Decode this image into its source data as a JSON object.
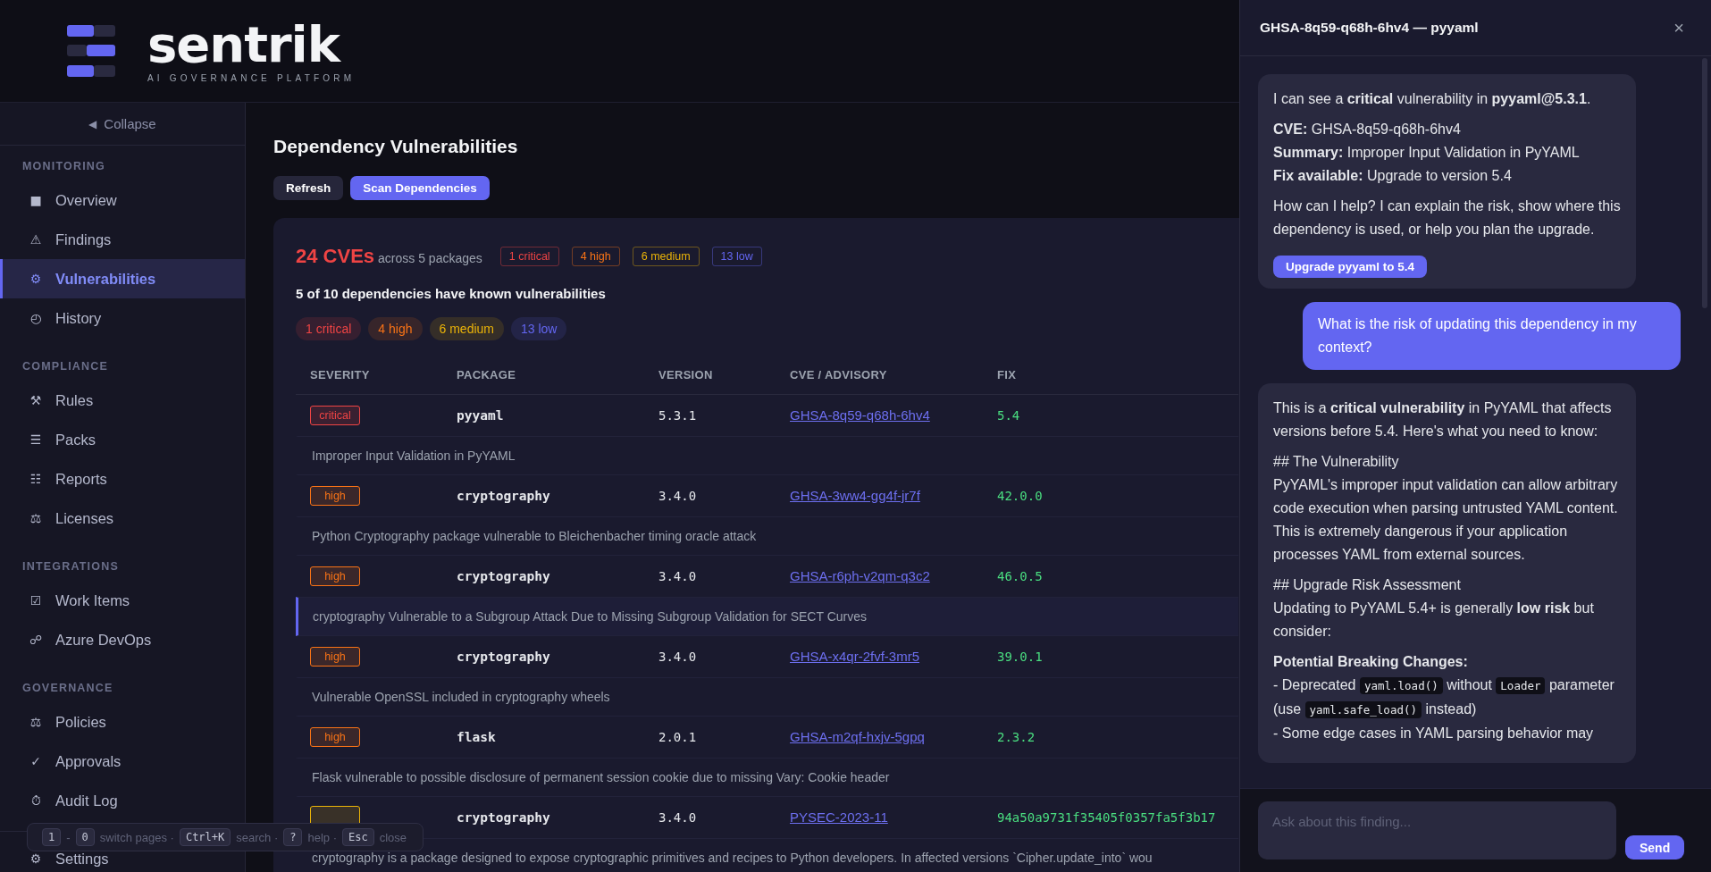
{
  "brand": {
    "name": "sentrik",
    "tagline": "AI GOVERNANCE PLATFORM"
  },
  "sidebar": {
    "collapse": {
      "icon": "◀",
      "label": "Collapse"
    },
    "sections": [
      {
        "label": "MONITORING",
        "items": [
          {
            "icon": "■",
            "label": "Overview",
            "selected": false
          },
          {
            "icon": "⚠",
            "label": "Findings",
            "selected": false
          },
          {
            "icon": "⚙",
            "label": "Vulnerabilities",
            "selected": true
          },
          {
            "icon": "◴",
            "label": "History",
            "selected": false
          }
        ]
      },
      {
        "label": "COMPLIANCE",
        "items": [
          {
            "icon": "⚒",
            "label": "Rules",
            "selected": false
          },
          {
            "icon": "☰",
            "label": "Packs",
            "selected": false
          },
          {
            "icon": "☷",
            "label": "Reports",
            "selected": false
          },
          {
            "icon": "⚖",
            "label": "Licenses",
            "selected": false
          }
        ]
      },
      {
        "label": "INTEGRATIONS",
        "items": [
          {
            "icon": "☑",
            "label": "Work Items",
            "selected": false
          },
          {
            "icon": "☍",
            "label": "Azure DevOps",
            "selected": false
          }
        ]
      },
      {
        "label": "GOVERNANCE",
        "items": [
          {
            "icon": "⚖",
            "label": "Policies",
            "selected": false
          },
          {
            "icon": "✓",
            "label": "Approvals",
            "selected": false
          },
          {
            "icon": "⏱",
            "label": "Audit Log",
            "selected": false
          }
        ]
      }
    ],
    "footer_items": [
      {
        "icon": "⚙",
        "label": "Settings",
        "selected": false
      }
    ]
  },
  "page": {
    "title": "Dependency Vulnerabilities",
    "actions": [
      {
        "label": "Refresh",
        "kind": "secondary"
      },
      {
        "label": "Scan Dependencies",
        "kind": "primary"
      }
    ]
  },
  "summary": {
    "count": "24 CVEs",
    "caption": "across 5 packages",
    "tags": [
      {
        "color": "#ef4444",
        "label": "1 critical"
      },
      {
        "color": "#f97316",
        "label": "4 high"
      },
      {
        "color": "#eab308",
        "label": "6 medium"
      },
      {
        "color": "#6366f1",
        "label": "13 low"
      }
    ],
    "headline": "5 of 10 dependencies have known vulnerabilities",
    "pills": [
      {
        "color": "#ef4444",
        "label": "1 critical"
      },
      {
        "color": "#f97316",
        "label": "4 high"
      },
      {
        "color": "#eab308",
        "label": "6 medium"
      },
      {
        "color": "#6366f1",
        "label": "13 low"
      }
    ]
  },
  "table": {
    "columns": [
      "SEVERITY",
      "PACKAGE",
      "VERSION",
      "CVE / ADVISORY",
      "FIX"
    ],
    "rows": [
      {
        "color": "#ef4444",
        "badge": "critical",
        "package": "pyyaml",
        "version": "5.3.1",
        "advisory": "GHSA-8q59-q68h-6hv4",
        "fix": "5.4",
        "description": "Improper Input Validation in PyYAML",
        "highlighted": false
      },
      {
        "color": "#f97316",
        "badge": "high",
        "package": "cryptography",
        "version": "3.4.0",
        "advisory": "GHSA-3ww4-gg4f-jr7f",
        "fix": "42.0.0",
        "description": "Python Cryptography package vulnerable to Bleichenbacher timing oracle attack",
        "highlighted": false
      },
      {
        "color": "#f97316",
        "badge": "high",
        "package": "cryptography",
        "version": "3.4.0",
        "advisory": "GHSA-r6ph-v2qm-q3c2",
        "fix": "46.0.5",
        "description": "cryptography Vulnerable to a Subgroup Attack Due to Missing Subgroup Validation for SECT Curves",
        "highlighted": true
      },
      {
        "color": "#f97316",
        "badge": "high",
        "package": "cryptography",
        "version": "3.4.0",
        "advisory": "GHSA-x4qr-2fvf-3mr5",
        "fix": "39.0.1",
        "description": "Vulnerable OpenSSL included in cryptography wheels",
        "highlighted": false
      },
      {
        "color": "#f97316",
        "badge": "high",
        "package": "flask",
        "version": "2.0.1",
        "advisory": "GHSA-m2qf-hxjv-5gpq",
        "fix": "2.3.2",
        "description": "Flask vulnerable to possible disclosure of permanent session cookie due to missing Vary: Cookie header",
        "highlighted": false
      },
      {
        "color": "#eab308",
        "package": "cryptography",
        "version": "3.4.0",
        "advisory": "PYSEC-2023-11",
        "fix": "94a50a9731f35405f0357fa5f3b17",
        "description": "cryptography is a package designed to expose cryptographic primitives and recipes to Python developers. In affected versions `Cipher.update_into` wou",
        "highlighted": false
      }
    ]
  },
  "hint_bar": {
    "items": [
      {
        "kind": "key",
        "text": "1"
      },
      {
        "kind": "text",
        "text": "-"
      },
      {
        "kind": "key",
        "text": "0"
      },
      {
        "kind": "text",
        "text": "switch pages ·"
      },
      {
        "kind": "key",
        "text": "Ctrl+K"
      },
      {
        "kind": "text",
        "text": "search ·"
      },
      {
        "kind": "key",
        "text": "?"
      },
      {
        "kind": "text",
        "text": "help ·"
      },
      {
        "kind": "key",
        "text": "Esc"
      },
      {
        "kind": "text",
        "text": "close"
      }
    ]
  },
  "panel": {
    "title": "GHSA-8q59-q68h-6hv4 — pyyaml",
    "close": "×",
    "messages": [
      {
        "kind": "assistant",
        "blocks": [
          {
            "lines": [
              "I can see a **critical** vulnerability in **pyyaml@5.3.1**."
            ]
          },
          {
            "lines": [
              "**CVE:** GHSA-8q59-q68h-6hv4",
              "**Summary:** Improper Input Validation in PyYAML",
              "**Fix available:** Upgrade to version 5.4"
            ]
          },
          {
            "lines": [
              "How can I help? I can explain the risk, show where this dependency is used, or help you plan the upgrade."
            ]
          }
        ],
        "action": "Upgrade pyyaml to 5.4"
      },
      {
        "kind": "user",
        "text": "What is the risk of updating this dependency in my context?"
      },
      {
        "kind": "assistant",
        "blocks": [
          {
            "lines": [
              "This is a **critical vulnerability** in PyYAML that affects versions before 5.4. Here's what you need to know:"
            ]
          },
          {
            "lines": [
              "## The Vulnerability",
              "PyYAML's improper input validation can allow arbitrary code execution when parsing untrusted YAML content. This is extremely dangerous if your application processes YAML from external sources."
            ]
          },
          {
            "lines": [
              "## Upgrade Risk Assessment",
              "Updating to PyYAML 5.4+ is generally **low risk** but consider:"
            ]
          },
          {
            "lines": [
              [
                {
                  "kind": "strong",
                  "text": "Potential Breaking Changes:"
                }
              ],
              [
                {
                  "kind": "text",
                  "text": "- Deprecated "
                },
                {
                  "kind": "code",
                  "text": "yaml.load()"
                },
                {
                  "kind": "text",
                  "text": " without "
                },
                {
                  "kind": "code",
                  "text": "Loader"
                },
                {
                  "kind": "text",
                  "text": " parameter (use "
                },
                {
                  "kind": "code",
                  "text": "yaml.safe_load()"
                },
                {
                  "kind": "text",
                  "text": " instead)"
                }
              ],
              "- Some edge cases in YAML parsing behavior may"
            ]
          }
        ]
      }
    ],
    "input": {
      "placeholder": "Ask about this finding..."
    },
    "send": "Send"
  }
}
